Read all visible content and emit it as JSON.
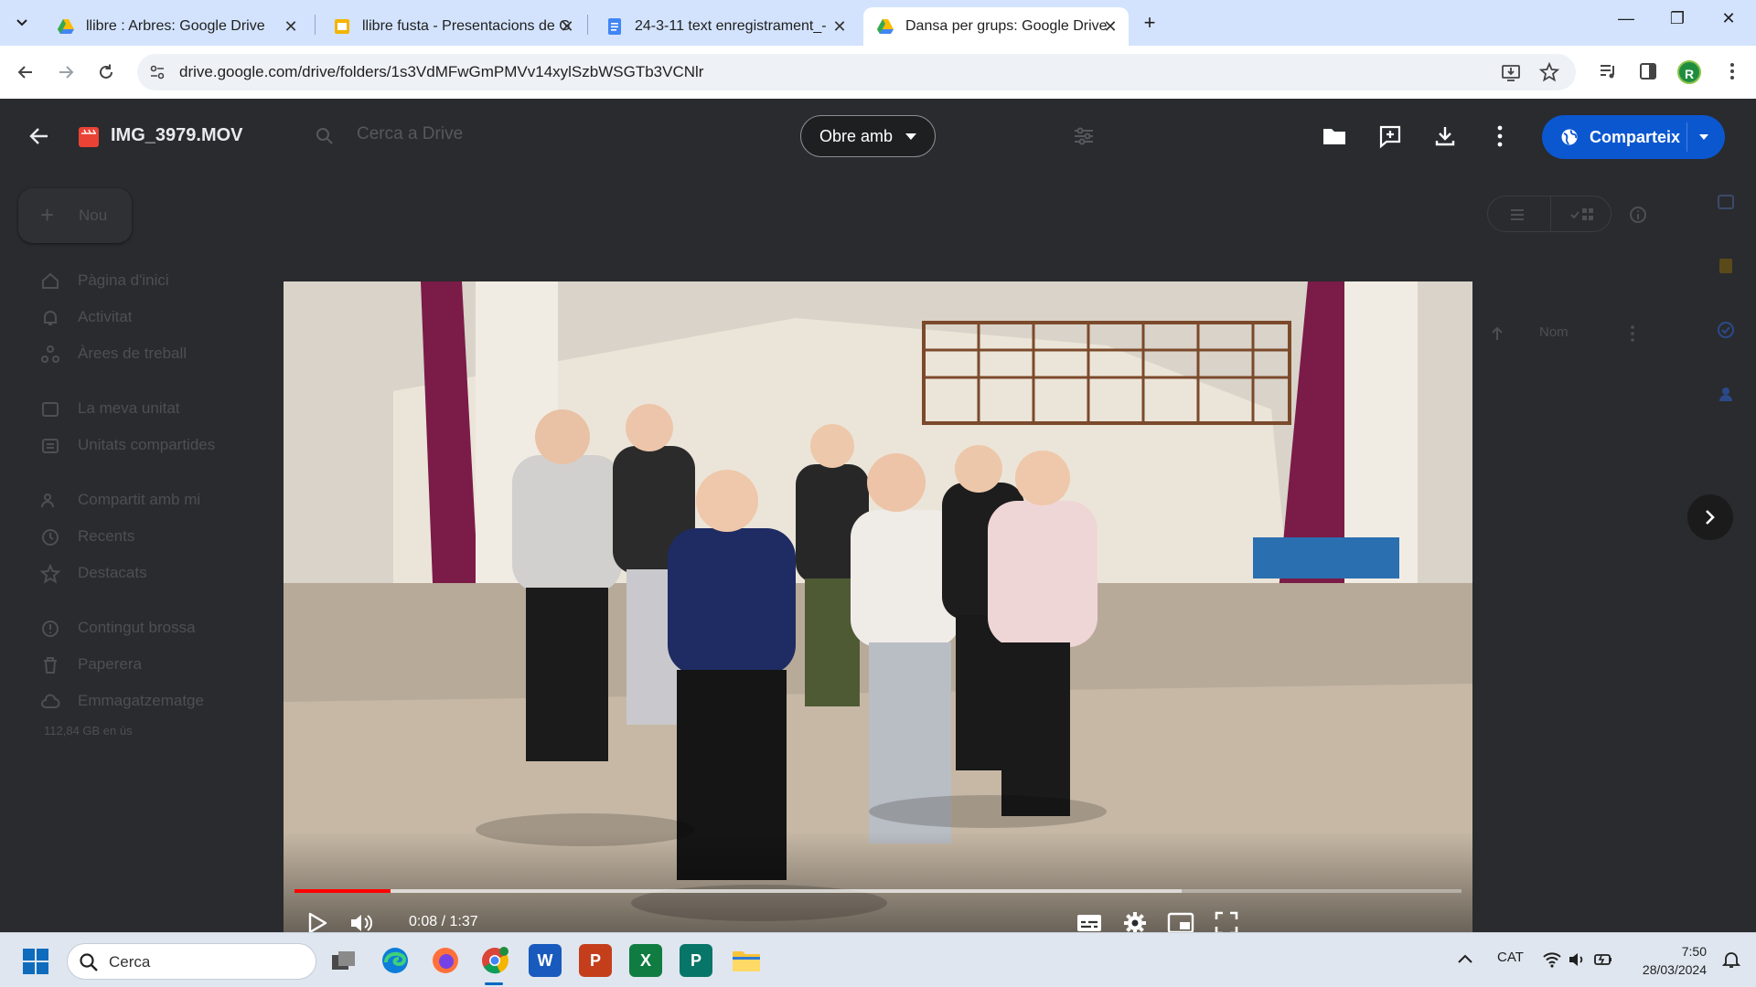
{
  "browser": {
    "tabs": [
      {
        "title": "llibre : Arbres: Google Drive",
        "icon": "google-drive-icon",
        "active": false
      },
      {
        "title": "llibre fusta - Presentacions de G",
        "icon": "google-slides-icon",
        "active": false
      },
      {
        "title": "24-3-11 text enregistrament_-",
        "icon": "google-docs-icon",
        "active": false
      },
      {
        "title": "Dansa per grups: Google Drive",
        "icon": "google-drive-icon",
        "active": true
      }
    ],
    "url": "drive.google.com/drive/folders/1s3VdMFwGmPMVv14xylSzbWSGTb3VCNlr",
    "profile_initial": "R"
  },
  "viewer": {
    "file_name": "IMG_3979.MOV",
    "open_with_label": "Obre amb",
    "share_label": "Comparteix",
    "search_placeholder": "Cerca a Drive",
    "video": {
      "current_time": "0:08",
      "duration": "1:37",
      "time_display": "0:08 / 1:37",
      "progress_fraction": 0.082,
      "buffered_fraction": 0.76
    }
  },
  "drive_background": {
    "new_label": "Nou",
    "nav": [
      {
        "label": "Pàgina d'inici",
        "icon": "home-icon"
      },
      {
        "label": "Activitat",
        "icon": "bell-icon"
      },
      {
        "label": "Àrees de treball",
        "icon": "workspaces-icon"
      },
      {
        "label": "La meva unitat",
        "icon": "my-drive-icon"
      },
      {
        "label": "Unitats compartides",
        "icon": "shared-drives-icon"
      },
      {
        "label": "Compartit amb mi",
        "icon": "people-icon"
      },
      {
        "label": "Recents",
        "icon": "clock-icon"
      },
      {
        "label": "Destacats",
        "icon": "star-icon"
      },
      {
        "label": "Contingut brossa",
        "icon": "spam-icon"
      },
      {
        "label": "Paperera",
        "icon": "trash-icon"
      },
      {
        "label": "Emmagatzematge",
        "icon": "cloud-icon"
      }
    ],
    "storage_text": "112,84 GB en ús",
    "sort_label": "Nom"
  },
  "taskbar": {
    "search_label": "Cerca",
    "language": "CAT",
    "time": "7:50",
    "date": "28/03/2024"
  },
  "colors": {
    "share_blue": "#0b57d0",
    "progress_red": "#ff0000",
    "tabstrip": "#d3e3fd"
  }
}
